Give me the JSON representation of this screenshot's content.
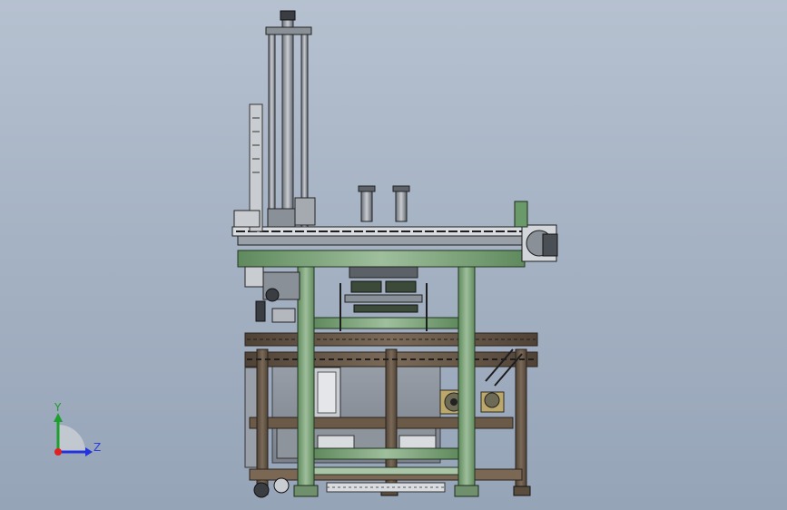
{
  "axis_triad": {
    "y_label": "Y",
    "z_label": "Z",
    "colors": {
      "y": "#1fa02e",
      "z": "#2233dd",
      "x": "#dd2222"
    }
  },
  "colors": {
    "background_top": "#b6c1d0",
    "background_bottom": "#96a4b8",
    "frame_green": "#7b9e79",
    "frame_brown": "#6b5a48",
    "metal_grey": "#8b9096",
    "dark_line": "#1d1d1d"
  }
}
